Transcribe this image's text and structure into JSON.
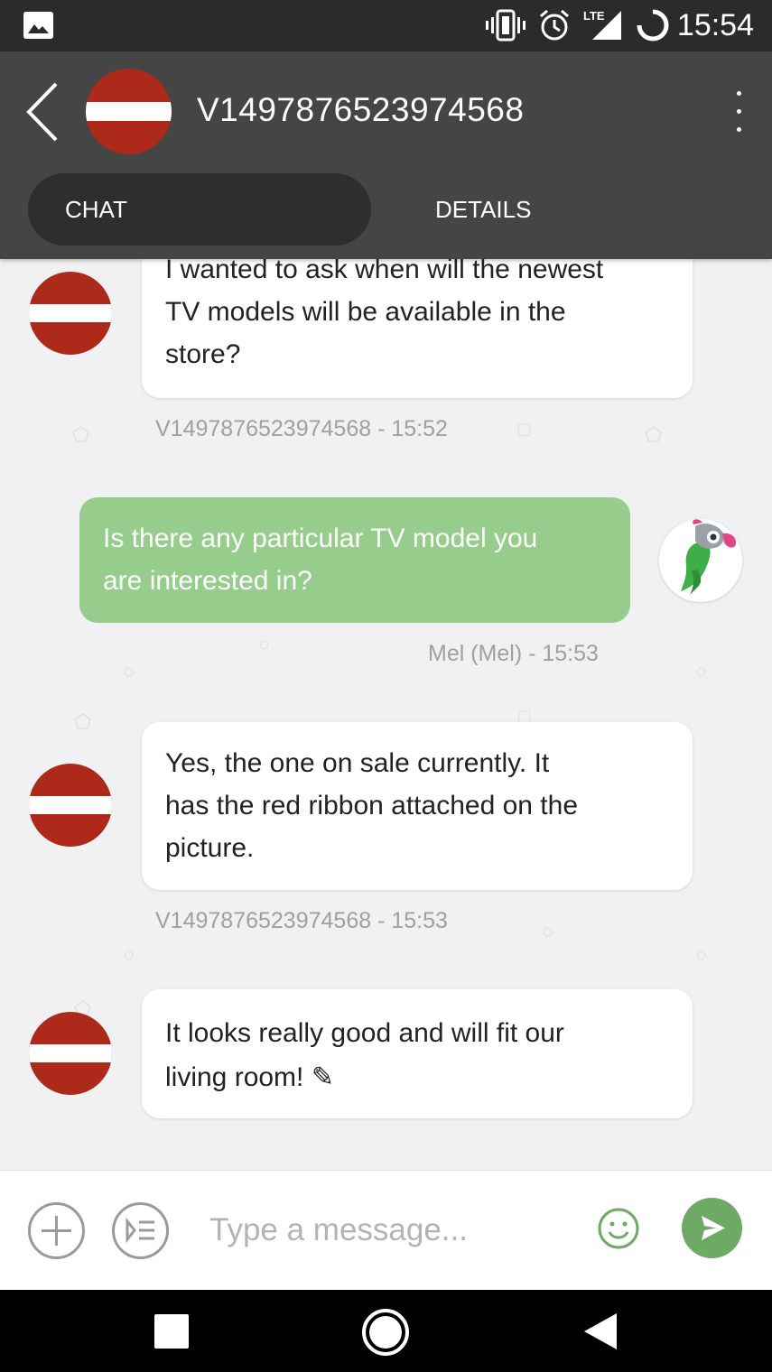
{
  "status_bar": {
    "time": "15:54",
    "network_label": "LTE",
    "icons": [
      "image-icon",
      "vibrate-icon",
      "alarm-icon",
      "lte-signal-icon",
      "battery-icon"
    ]
  },
  "header": {
    "title": "V1497876523974568",
    "tabs": [
      {
        "label": "CHAT",
        "active": true
      },
      {
        "label": "DETAILS",
        "active": false
      }
    ],
    "avatar_colors": {
      "red": "#ad2a1b",
      "white": "#ffffff"
    }
  },
  "messages": [
    {
      "direction": "incoming",
      "lines": [
        "I wanted to ask when will the newest",
        "TV models will be available in the",
        "store?"
      ],
      "meta": "V1497876523974568 - 15:52"
    },
    {
      "direction": "outgoing",
      "lines": [
        "Is there any particular TV model you",
        "are interested in?"
      ],
      "meta": "Mel (Mel) - 15:53"
    },
    {
      "direction": "incoming",
      "lines": [
        "Yes, the one on sale currently. It",
        "has the red ribbon attached on the",
        "picture."
      ],
      "meta": "V1497876523974568 - 15:53"
    },
    {
      "direction": "incoming",
      "lines": [
        "It looks really good and will fit our",
        "living room! ✎"
      ],
      "meta": ""
    }
  ],
  "composer": {
    "placeholder": "Type a message..."
  },
  "colors": {
    "status_bar": "#2b2b2b",
    "app_bar": "#454545",
    "active_tab": "#2e2e2e",
    "outgoing_bubble": "#96cd8c",
    "send_button": "#6ea966",
    "chat_background": "#f1f1f3"
  }
}
